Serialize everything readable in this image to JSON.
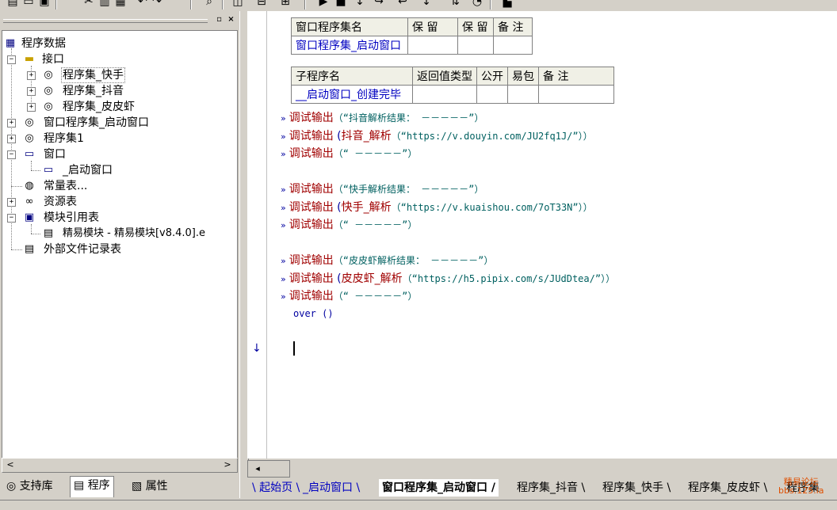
{
  "toolbar": {
    "icons": [
      "new-file-icon",
      "open-folder-icon",
      "save-icon",
      "cut-icon",
      "copy-icon",
      "paste-icon",
      "undo-icon",
      "redo-icon",
      "find-icon",
      "layout-1-icon",
      "layout-2-icon",
      "layout-3-icon",
      "run-icon",
      "stop-icon",
      "step-icons",
      "breakpoint-icons",
      "compile-icon"
    ]
  },
  "tree": {
    "root": "程序数据",
    "items": [
      {
        "label": "接口"
      },
      {
        "label": "程序集_快手"
      },
      {
        "label": "程序集_抖音"
      },
      {
        "label": "程序集_皮皮虾"
      },
      {
        "label": "窗口程序集_启动窗口"
      },
      {
        "label": "程序集1"
      },
      {
        "label": "窗口"
      },
      {
        "label": "_启动窗口"
      },
      {
        "label": "常量表..."
      },
      {
        "label": "资源表"
      },
      {
        "label": "模块引用表"
      },
      {
        "label": "精易模块 - 精易模块[v8.4.0].e"
      },
      {
        "label": "外部文件记录表"
      }
    ]
  },
  "left_tabs": [
    "支持库",
    "程序",
    "属性"
  ],
  "class_table": {
    "headers": [
      "窗口程序集名",
      "保 留",
      "保 留",
      "备 注"
    ],
    "row": [
      "窗口程序集_启动窗口",
      "",
      "",
      ""
    ]
  },
  "sub_table": {
    "headers": [
      "子程序名",
      "返回值类型",
      "公开",
      "易包",
      "备 注"
    ],
    "row": [
      "__启动窗口_创建完毕",
      "",
      "",
      "",
      ""
    ]
  },
  "code": {
    "marker": "»",
    "lines": [
      {
        "fn": "调试输出",
        "args": "（“抖音解析结果： －－－－－”）"
      },
      {
        "fn": "调试输出",
        "pre": " (",
        "inner": "抖音_解析",
        "args": "（“https://v.douyin.com/JU2fq1J/”））"
      },
      {
        "fn": "调试输出",
        "args": "（“ －－－－－”）"
      },
      {
        "fn": "调试输出",
        "args": "（“快手解析结果： －－－－－”）"
      },
      {
        "fn": "调试输出",
        "pre": " (",
        "inner": "快手_解析",
        "args": "（“https://v.kuaishou.com/7oT33N”））"
      },
      {
        "fn": "调试输出",
        "args": "（“ －－－－－”）"
      },
      {
        "fn": "调试输出",
        "args": "（“皮皮虾解析结果： －－－－－”）"
      },
      {
        "fn": "调试输出",
        "pre": " (",
        "inner": "皮皮虾_解析",
        "args": "（“https://h5.pipix.com/s/JUdDtea/”））"
      },
      {
        "fn": "调试输出",
        "args": "（“ －－－－－”）"
      }
    ],
    "over": "over ()",
    "arrow": "↓"
  },
  "right_tabs": [
    "起始页",
    "_启动窗口",
    "窗口程序集_启动窗口",
    "程序集_抖音",
    "程序集_快手",
    "程序集_皮皮虾",
    "程序集"
  ],
  "watermark": {
    "line1": "精易论坛",
    "line2": "bbs.125.la"
  }
}
